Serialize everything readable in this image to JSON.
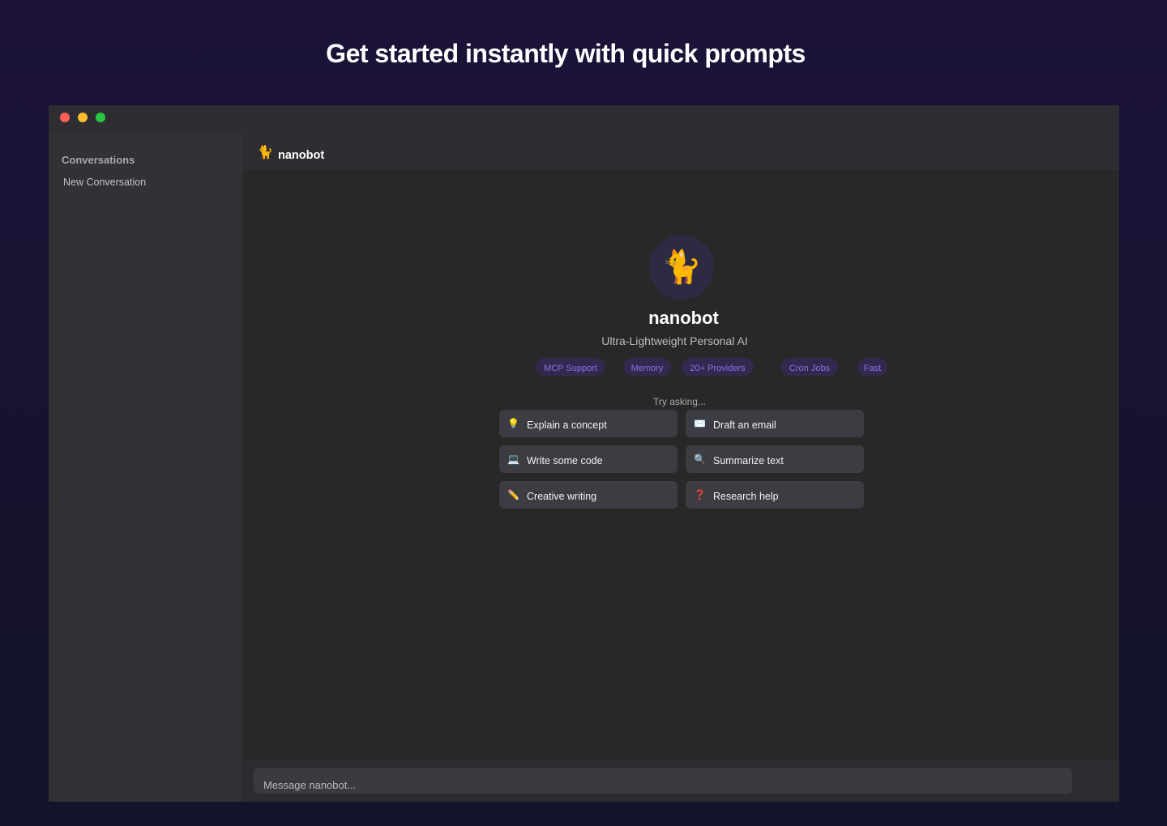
{
  "hero": {
    "title": "Get started instantly with quick prompts"
  },
  "sidebar": {
    "heading": "Conversations",
    "items": [
      {
        "label": "New Conversation"
      }
    ]
  },
  "header": {
    "logo_icon": "🐈",
    "title": "nanobot"
  },
  "welcome": {
    "avatar_icon": "🐈",
    "name": "nanobot",
    "tagline": "Ultra-Lightweight Personal AI",
    "features": [
      "MCP Support",
      "Memory",
      "20+ Providers",
      "Cron Jobs",
      "Fast"
    ],
    "try_label": "Try asking..."
  },
  "prompts": [
    {
      "icon": "💡",
      "icon_name": "lightbulb-icon",
      "label": "Explain a concept"
    },
    {
      "icon": "✉️",
      "icon_name": "envelope-icon",
      "label": "Draft an email"
    },
    {
      "icon": "💻",
      "icon_name": "laptop-icon",
      "label": "Write some code"
    },
    {
      "icon": "🔍",
      "icon_name": "magnifier-icon",
      "label": "Summarize text"
    },
    {
      "icon": "✏️",
      "icon_name": "pencil-icon",
      "label": "Creative writing"
    },
    {
      "icon": "❓",
      "icon_name": "question-mark-icon",
      "label": "Research help"
    }
  ],
  "composer": {
    "placeholder": "Message nanobot...",
    "value": ""
  },
  "colors": {
    "page_bg": "#1c1238",
    "window_bg": "#282828",
    "sidebar_bg": "#323236",
    "chip_bg": "#33294f",
    "chip_text": "#8f6ee8",
    "prompt_bg": "#3c3c42"
  }
}
